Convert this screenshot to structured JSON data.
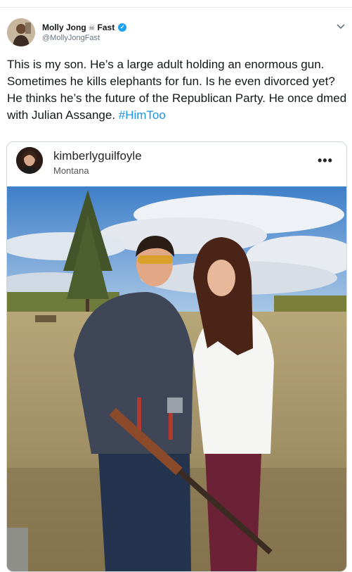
{
  "tweet": {
    "display_name": "Molly Jong",
    "name_emoji": "☠",
    "display_name_suffix": "Fast",
    "handle": "@MollyJongFast",
    "text": "This is my son. He’s a large adult holding an enormous gun. Sometimes he kills elephants for fun. Is he even divorced yet? He thinks he’s the future of the Republican Party. He once dmed with Julian Assange. ",
    "hashtag": "#HimToo",
    "verified_icon": "verified-badge-icon",
    "menu_icon": "chevron-down-icon"
  },
  "embed": {
    "username": "kimberlyguilfoyle",
    "location": "Montana",
    "more_label": "•••"
  },
  "colors": {
    "link": "#1b95e0",
    "verified": "#1da1f2",
    "secondary_text": "#657786",
    "border": "#ccd6dd"
  }
}
